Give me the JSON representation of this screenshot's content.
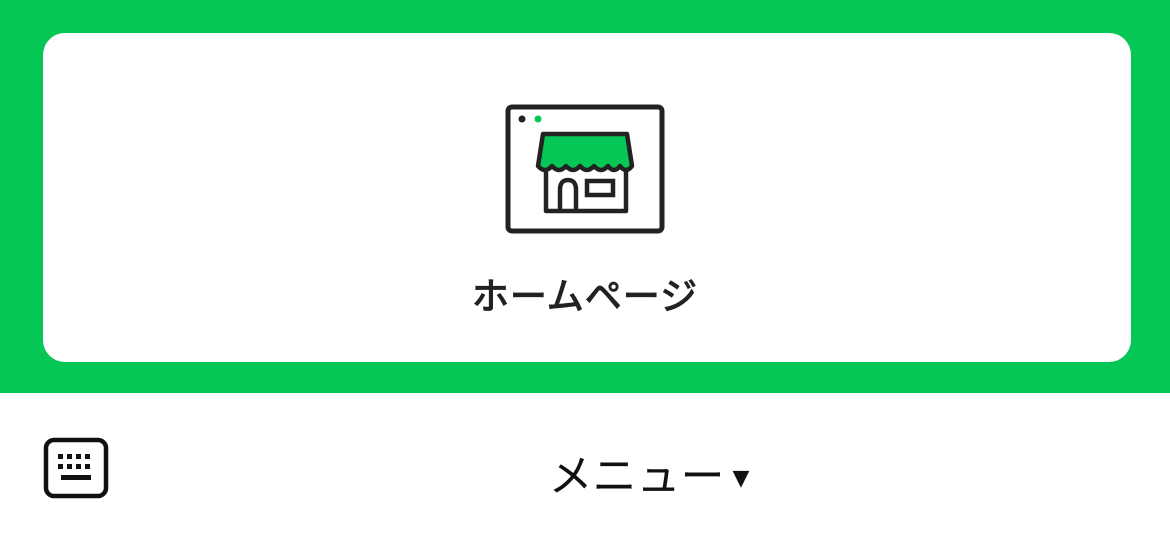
{
  "rich_menu": {
    "background_color": "#06C755",
    "card": {
      "icon": "storefront-browser-icon",
      "label": "ホームページ"
    }
  },
  "bottom_bar": {
    "keyboard_icon": "keyboard-icon",
    "menu_label": "メニュー",
    "menu_caret": "▼"
  }
}
